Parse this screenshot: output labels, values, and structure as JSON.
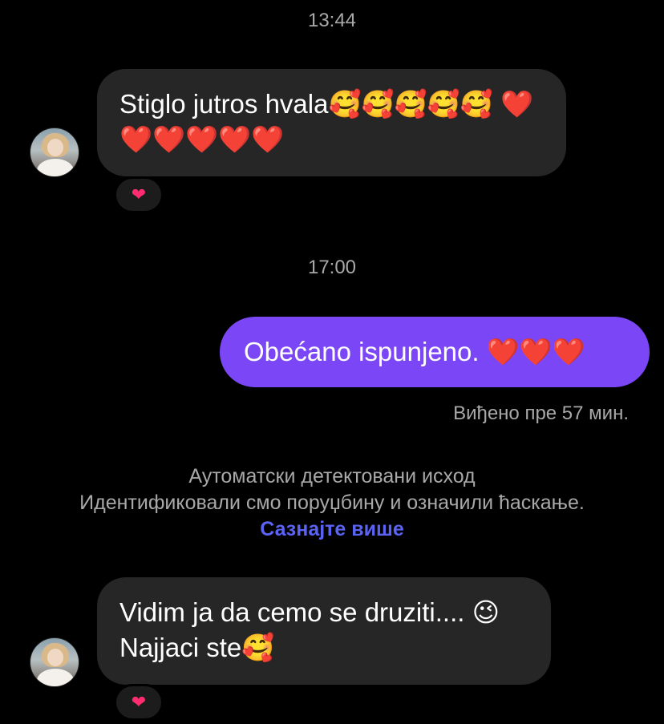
{
  "timestamps": [
    "13:44",
    "17:00"
  ],
  "messages": [
    {
      "direction": "incoming",
      "text": "Stiglo jutros hvala🥰🥰🥰🥰🥰 ❤️❤️❤️❤️❤️❤️",
      "reaction": "❤"
    },
    {
      "direction": "outgoing",
      "text": "Obećano ispunjeno. ❤️❤️❤️"
    },
    {
      "direction": "incoming",
      "text": "Vidim ja da cemo se druziti.... 😉 Najjaci ste🥰",
      "reaction": "❤"
    }
  ],
  "seen_status": "Виђено пре 57 мин.",
  "auto_detect": {
    "title": "Аутоматски детектовани исход",
    "body": "Идентификовали смо поруџбину и означили ћаскање.",
    "link": "Сазнајте више"
  },
  "colors": {
    "background": "#000000",
    "incoming_bubble": "#262626",
    "outgoing_bubble": "#7b47f6",
    "link": "#5b63f5",
    "muted_text": "#a8a8a8"
  },
  "icons": {
    "reaction": "heart-icon",
    "avatar": "contact-avatar"
  }
}
